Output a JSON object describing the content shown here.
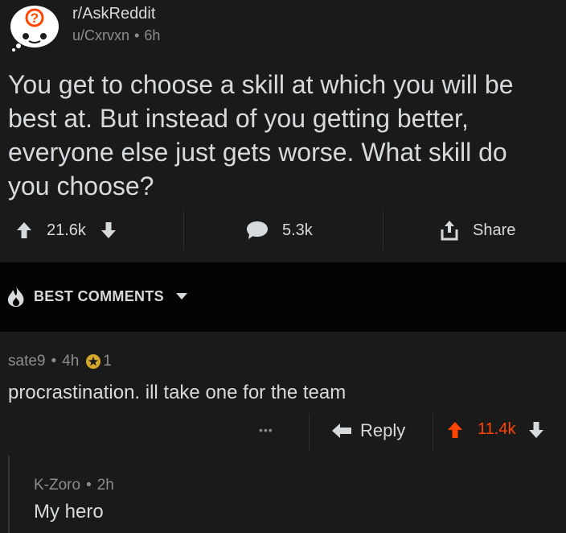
{
  "post": {
    "subreddit": "r/AskReddit",
    "author": "u/Cxrvxn",
    "meta_separator": "•",
    "age": "6h",
    "title": "You get to choose a skill at which you will be best at. But instead of you getting better, everyone else just gets worse. What skill do you choose?",
    "score": "21.6k",
    "comments_count": "5.3k",
    "share_label": "Share"
  },
  "sort": {
    "label": "BEST COMMENTS"
  },
  "comments": [
    {
      "author": "sate9",
      "age": "4h",
      "award_count": "1",
      "body": "procrastination. ill take one for the team",
      "reply_label": "Reply",
      "more_label": "•••",
      "score": "11.4k"
    },
    {
      "author": "K-Zoro",
      "age": "2h",
      "body": "My hero"
    }
  ],
  "colors": {
    "background": "#1a1a1b",
    "text": "#d7dadc",
    "muted": "#8b8d90",
    "upvoted": "#ff4500",
    "award": "#d4a72c"
  },
  "icons": {
    "subreddit": "askreddit-avatar-icon",
    "upvote": "arrow-up-icon",
    "downvote": "arrow-down-icon",
    "comment": "speech-bubble-icon",
    "share": "share-icon",
    "sort": "flame-icon",
    "dropdown": "caret-down-icon",
    "award": "award-icon",
    "reply": "reply-arrow-icon",
    "more": "more-dots-icon"
  }
}
